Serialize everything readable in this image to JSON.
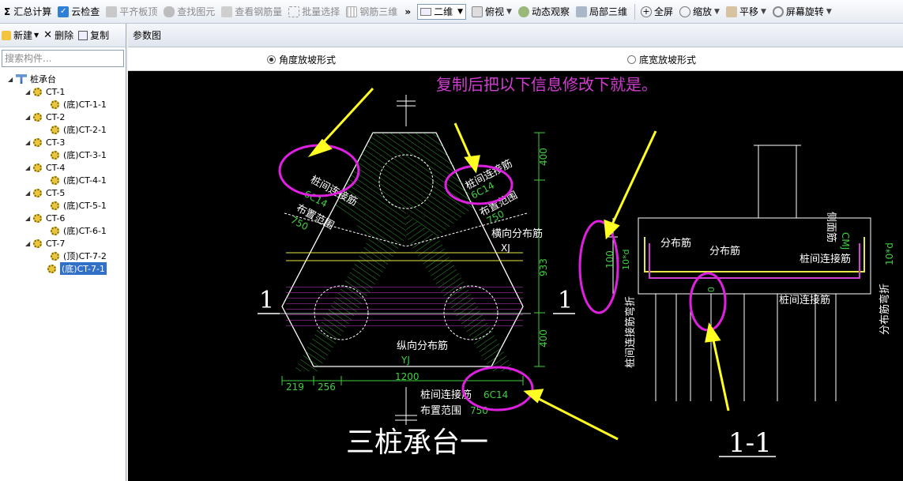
{
  "toolbar": {
    "items": [
      {
        "label": "汇总计算",
        "icon": "sigma-icon"
      },
      {
        "label": "云检查",
        "icon": "check-icon"
      },
      {
        "label": "平齐板顶",
        "icon": "align-icon"
      },
      {
        "label": "查找图元",
        "icon": "binoculars-icon"
      },
      {
        "label": "查看钢筋量",
        "icon": "rebar-icon"
      },
      {
        "label": "批量选择",
        "icon": "select-icon"
      },
      {
        "label": "钢筋三维",
        "icon": "rebar3d-icon"
      }
    ],
    "more": "»",
    "view_mode": "二维",
    "right_items": [
      {
        "label": "俯视",
        "icon": "cube-icon"
      },
      {
        "label": "动态观察",
        "icon": "orbit-icon"
      },
      {
        "label": "局部三维",
        "icon": "local3d-icon"
      },
      {
        "label": "全屏",
        "icon": "zoom-icon"
      },
      {
        "label": "缩放",
        "icon": "magnify-icon"
      },
      {
        "label": "平移",
        "icon": "hand-icon"
      },
      {
        "label": "屏幕旋转",
        "icon": "rotate-icon"
      }
    ]
  },
  "left": {
    "new_label": "新建",
    "delete_label": "删除",
    "copy_label": "复制",
    "search_placeholder": "搜索构件...",
    "tree_root": "桩承台",
    "tree": [
      {
        "label": "CT-1",
        "level": 1
      },
      {
        "label": "(底)CT-1-1",
        "level": 2
      },
      {
        "label": "CT-2",
        "level": 1
      },
      {
        "label": "(底)CT-2-1",
        "level": 2
      },
      {
        "label": "CT-3",
        "level": 1
      },
      {
        "label": "(底)CT-3-1",
        "level": 2
      },
      {
        "label": "CT-4",
        "level": 1
      },
      {
        "label": "(底)CT-4-1",
        "level": 2
      },
      {
        "label": "CT-5",
        "level": 1
      },
      {
        "label": "(底)CT-5-1",
        "level": 2
      },
      {
        "label": "CT-6",
        "level": 1
      },
      {
        "label": "(底)CT-6-1",
        "level": 2
      },
      {
        "label": "CT-7",
        "level": 1
      },
      {
        "label": "(顶)CT-7-2",
        "level": 2
      },
      {
        "label": "(底)CT-7-1",
        "level": 2,
        "selected": true
      }
    ]
  },
  "main": {
    "title": "参数图",
    "radio1": "角度放坡形式",
    "radio2": "底宽放坡形式",
    "radio_selected": 1
  },
  "drawing": {
    "annotation": "复制后把以下信息修改下就是。",
    "plan": {
      "title": "三桩承台一",
      "section_mark_left": "1",
      "section_mark_right": "1",
      "left_text1": "桩间连接筋",
      "left_value": "6C14",
      "left_text2": "布置范围",
      "left_range": "750",
      "right_text1": "桩间连接筋",
      "right_value": "6C14",
      "right_text2": "布置范围",
      "right_range": "750",
      "transverse": "横向分布筋",
      "transverse_code": "XJ",
      "longitudinal": "纵向分布筋",
      "longitudinal_code": "YJ",
      "bottom_text1": "桩间连接筋",
      "bottom_value": "6C14",
      "bottom_text2": "布置范围",
      "bottom_range": "750",
      "dim_top": "400",
      "dim_mid": "933",
      "dim_bot": "400",
      "dim_width": "1200",
      "dim_a": "219",
      "dim_b": "256"
    },
    "section": {
      "title": "1-1",
      "dist1": "分布筋",
      "dist2": "分布筋",
      "conn1": "桩间连接筋",
      "conn2": "桩间连接筋",
      "side": "侧面筋",
      "side_code": "CMJ",
      "dim_100": "100",
      "dim_10d": "10*d",
      "dim_10d_right": "10*d",
      "zero": "0",
      "left_vertical": "桩间连接筋弯折",
      "right_vertical": "分布筋弯折"
    }
  }
}
